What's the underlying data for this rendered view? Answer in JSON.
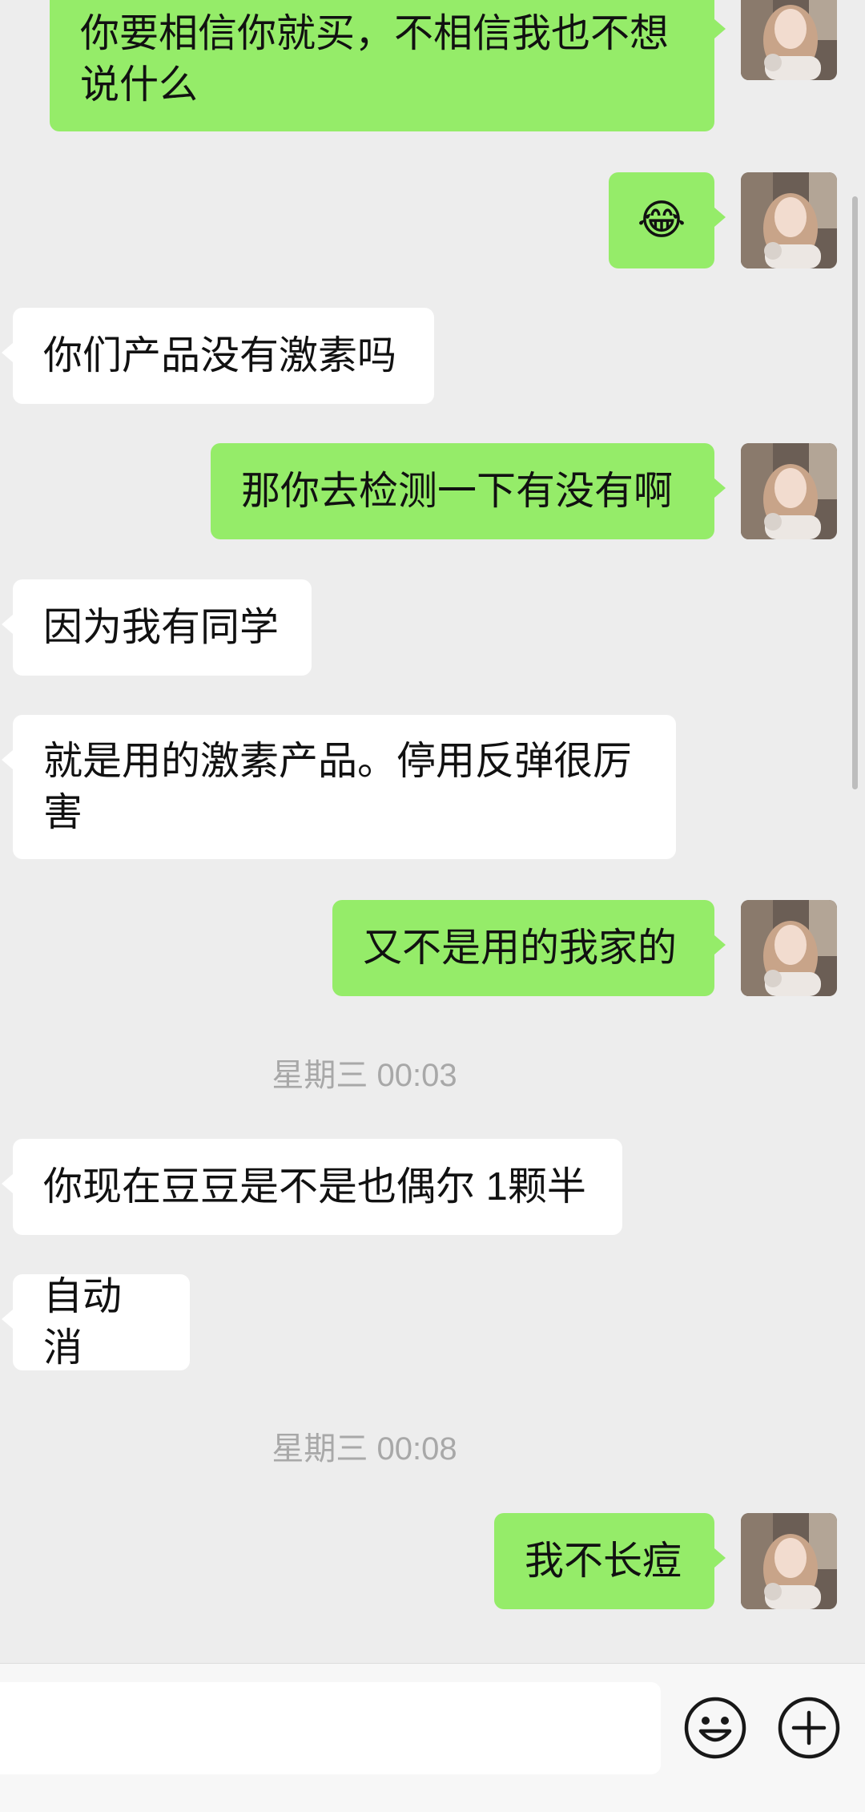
{
  "messages": [
    {
      "side": "out",
      "text": "你要相信你就买，不相信我也不想说什么"
    },
    {
      "side": "out",
      "emoji": "😂"
    },
    {
      "side": "in",
      "text": "你们产品没有激素吗"
    },
    {
      "side": "out",
      "text": "那你去检测一下有没有啊"
    },
    {
      "side": "in",
      "text": "因为我有同学"
    },
    {
      "side": "in",
      "text": "就是用的激素产品。停用反弹很厉害"
    },
    {
      "side": "out",
      "text": "又不是用的我家的"
    },
    {
      "time": "星期三 00:03"
    },
    {
      "side": "in",
      "text": "你现在豆豆是不是也偶尔 1颗半"
    },
    {
      "side": "in",
      "text": "自动消"
    },
    {
      "time": "星期三 00:08"
    },
    {
      "side": "out",
      "text": "我不长痘"
    }
  ],
  "input": {
    "value": ""
  },
  "colors": {
    "outgoing_bubble": "#95EC69",
    "incoming_bubble": "#FFFFFF",
    "background": "#EDEDED"
  },
  "icons": {
    "emoji": "smiley-icon",
    "more": "plus-circle-icon"
  }
}
